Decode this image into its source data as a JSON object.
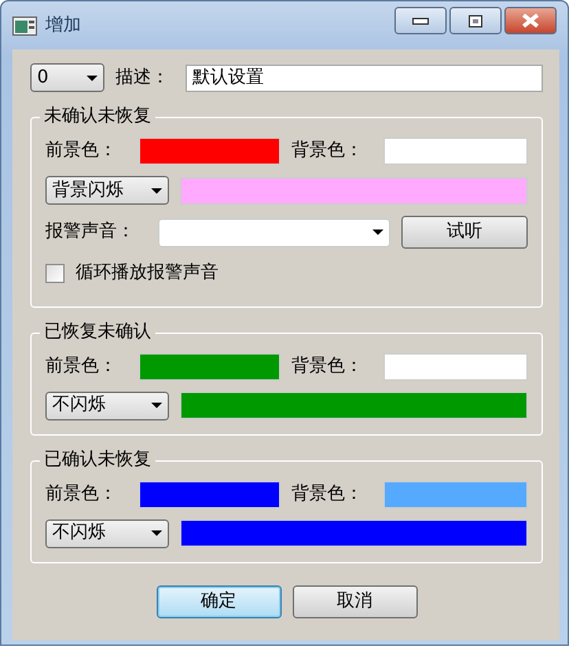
{
  "window": {
    "title": "增加"
  },
  "header": {
    "id_select": "0",
    "description_label": "描述：",
    "description_value": "默认设置"
  },
  "groups": [
    {
      "title": "未确认未恢复",
      "foreground": {
        "label": "前景色：",
        "color": "#ff0000"
      },
      "background": {
        "label": "背景色：",
        "color": "#ffffff"
      },
      "blink_select": "背景闪烁",
      "blink": {
        "color": "#ffaaff"
      },
      "sound": {
        "label": "报警声音：",
        "test_button": "试听",
        "loop": {
          "label": "循环播放报警声音",
          "checked": false
        }
      }
    },
    {
      "title": "已恢复未确认",
      "foreground": {
        "label": "前景色：",
        "color": "#009900"
      },
      "background": {
        "label": "背景色：",
        "color": "#ffffff"
      },
      "blink_select": "不闪烁",
      "blink": {
        "color": "#009900"
      }
    },
    {
      "title": "已确认未恢复",
      "foreground": {
        "label": "前景色：",
        "color": "#0000ff"
      },
      "background": {
        "label": "背景色：",
        "color": "#55aaff"
      },
      "blink_select": "不闪烁",
      "blink": {
        "color": "#0000ff"
      }
    }
  ],
  "buttons": [
    {
      "label": "确定",
      "default": true
    },
    {
      "label": "取消",
      "default": false
    }
  ]
}
